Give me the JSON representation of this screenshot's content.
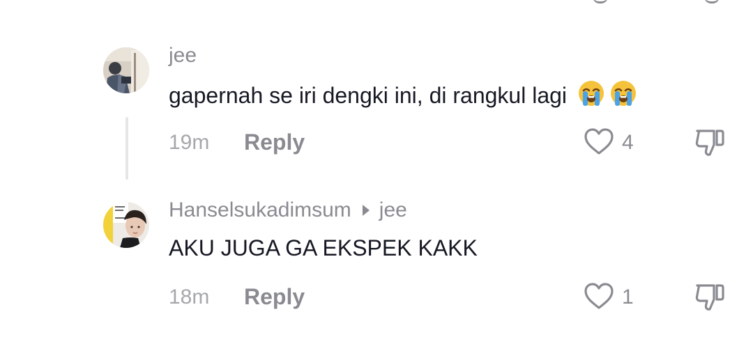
{
  "comments": [
    {
      "author": "jee",
      "reply_to": null,
      "text": "gapernah se iri dengki ini, di rangkul lagi",
      "emojis": [
        "loudly-crying-face",
        "loudly-crying-face"
      ],
      "time": "19m",
      "reply_label": "Reply",
      "likes": "4"
    },
    {
      "author": "Hanselsukadimsum",
      "reply_to": "jee",
      "text": "AKU JUGA GA EKSPEK KAKK",
      "emojis": [],
      "time": "18m",
      "reply_label": "Reply",
      "likes": "1"
    }
  ],
  "colors": {
    "primary_text": "#161823",
    "secondary_text": "#8a8b91",
    "timestamp": "#a6a7ab",
    "thread_line": "#e6e6e8"
  },
  "icons": [
    "heart-outline-icon",
    "thumbs-down-icon",
    "reply-arrow-icon"
  ]
}
